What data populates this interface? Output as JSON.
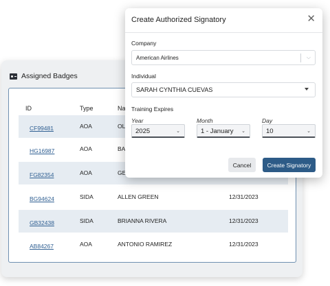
{
  "badges_panel": {
    "title": "Assigned Badges",
    "columns": {
      "id": "ID",
      "type": "Type",
      "name": "Na"
    },
    "rows": [
      {
        "id": "CF99481",
        "type": "AOA",
        "name": "OL",
        "expires": ""
      },
      {
        "id": "HG16987",
        "type": "AOA",
        "name": "BA",
        "expires": ""
      },
      {
        "id": "FG82354",
        "type": "AOA",
        "name": "GE",
        "expires": ""
      },
      {
        "id": "BG94624",
        "type": "SIDA",
        "name": "ALLEN GREEN",
        "expires": "12/31/2023"
      },
      {
        "id": "GB32438",
        "type": "SIDA",
        "name": "BRIANNA RIVERA",
        "expires": "12/31/2023"
      },
      {
        "id": "AB84267",
        "type": "AOA",
        "name": "ANTONIO RAMIREZ",
        "expires": "12/31/2023"
      }
    ]
  },
  "modal": {
    "title": "Create Authorized Signatory",
    "close_symbol": "✕",
    "company_label": "Company",
    "company_value": "American Airlines",
    "individual_label": "Individual",
    "individual_value": "SARAH CYNTHIA CUEVAS",
    "training_label": "Training Expires",
    "year_label": "Year",
    "year_value": "2025",
    "month_label": "Month",
    "month_value": "1 - January",
    "day_label": "Day",
    "day_value": "10",
    "cancel_label": "Cancel",
    "create_label": "Create Signatory"
  },
  "icons": {
    "badge": "id-card-icon",
    "close": "close-icon",
    "chevron": "chevron-down-icon"
  },
  "colors": {
    "primary_button": "#2d5b87",
    "link": "#2f5f92",
    "row_shade": "#e6ecf2",
    "panel_border": "#6e8fb0"
  }
}
